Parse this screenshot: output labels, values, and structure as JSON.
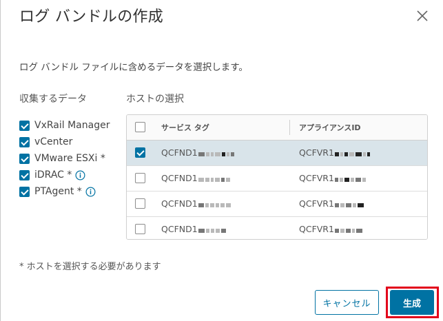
{
  "dialog": {
    "title": "ログ バンドルの作成",
    "description": "ログ バンドル ファイルに含めるデータを選択します。",
    "close_icon": "close-icon"
  },
  "collect": {
    "label": "収集するデータ",
    "items": [
      {
        "label": "VxRail Manager",
        "checked": true,
        "info": false
      },
      {
        "label": "vCenter",
        "checked": true,
        "info": false
      },
      {
        "label": "VMware ESXi *",
        "checked": true,
        "info": false
      },
      {
        "label": "iDRAC *",
        "checked": true,
        "info": true
      },
      {
        "label": "PTAgent *",
        "checked": true,
        "info": true
      }
    ]
  },
  "hosts": {
    "label": "ホストの選択",
    "columns": [
      "サービス タグ",
      "アプライアンスID"
    ],
    "rows": [
      {
        "service_tag": "QCFND1",
        "appliance_id": "QCFVR1",
        "checked": true
      },
      {
        "service_tag": "QCFND1",
        "appliance_id": "QCFVR1",
        "checked": false
      },
      {
        "service_tag": "QCFND1",
        "appliance_id": "QCFVR1",
        "checked": false
      },
      {
        "service_tag": "QCFND1",
        "appliance_id": "QCFVR1",
        "checked": false
      }
    ]
  },
  "footnote": "* ホストを選択する必要があります",
  "buttons": {
    "cancel": "キャンセル",
    "generate": "生成"
  },
  "colors": {
    "accent": "#0072a3",
    "highlight_frame": "#e2001a",
    "selected_row": "#d9e4ea"
  }
}
